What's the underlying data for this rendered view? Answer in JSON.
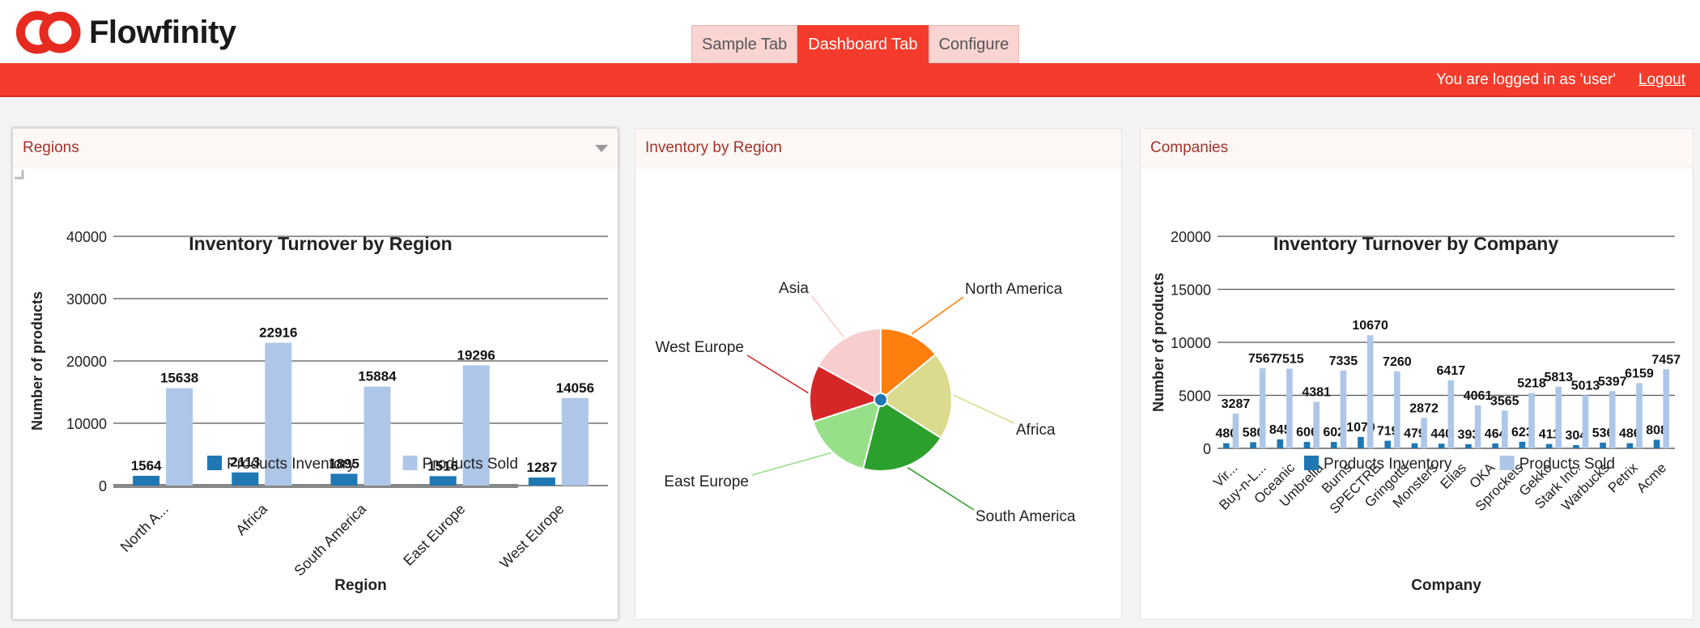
{
  "app": {
    "brand": "Flowfinity",
    "brand_color": "#e62a1f"
  },
  "tabs": [
    {
      "label": "Sample Tab",
      "active": false
    },
    {
      "label": "Dashboard Tab",
      "active": true
    },
    {
      "label": "Configure",
      "active": false
    }
  ],
  "topbar": {
    "login_text": "You are logged in as 'user'",
    "logout_label": "Logout",
    "color": "#f53c2c"
  },
  "panels": {
    "regions": {
      "title": "Regions"
    },
    "inventory": {
      "title": "Inventory by Region"
    },
    "companies": {
      "title": "Companies"
    }
  },
  "chart_data": [
    {
      "type": "bar",
      "title": "Inventory Turnover by Region",
      "xlabel": "Region",
      "ylabel": "Number of products",
      "ylim": [
        0,
        40000
      ],
      "yticks": [
        0,
        10000,
        20000,
        30000,
        40000
      ],
      "grid": true,
      "legend_position": "bottom",
      "categories": [
        "North A...",
        "Africa",
        "South America",
        "East Europe",
        "West Europe"
      ],
      "series": [
        {
          "name": "Products Inventory",
          "color": "#1f77b4",
          "values": [
            1564,
            2113,
            1895,
            1516,
            1287
          ]
        },
        {
          "name": "Products Sold",
          "color": "#aec7e8",
          "values": [
            15638,
            22916,
            15884,
            19296,
            14056
          ]
        }
      ]
    },
    {
      "type": "pie",
      "categories": [
        "North America",
        "Africa",
        "South America",
        "East Europe",
        "West Europe",
        "Asia"
      ],
      "values": [
        14,
        20,
        20,
        16,
        13,
        17
      ],
      "colors": [
        "#ff7f0e",
        "#dbdb8d",
        "#2ca02c",
        "#98df8a",
        "#d62728",
        "#f7cdcd"
      ]
    },
    {
      "type": "bar",
      "title": "Inventory Turnover by Company",
      "xlabel": "Company",
      "ylabel": "Number of products",
      "ylim": [
        0,
        20000
      ],
      "yticks": [
        0,
        5000,
        10000,
        15000,
        20000
      ],
      "grid": true,
      "legend_position": "bottom",
      "categories": [
        "Vir...",
        "Buy-n-L...",
        "Oceanic",
        "Umbrella",
        "Burns",
        "SPECTRE",
        "Gringotts",
        "Monsters",
        "Elias",
        "OKA",
        "Sprockets",
        "Gekko",
        "Stark Inc.",
        "Warbucks",
        "Petrix",
        "Acme"
      ],
      "series": [
        {
          "name": "Products Inventory",
          "color": "#1f77b4",
          "values": [
            480,
            580,
            845,
            606,
            602,
            1070,
            719,
            479,
            440,
            393,
            464,
            623,
            411,
            304,
            536,
            486,
            808
          ]
        },
        {
          "name": "Products Sold",
          "color": "#aec7e8",
          "values": [
            3287,
            7567,
            7515,
            4381,
            7335,
            10670,
            7260,
            2872,
            6417,
            4061,
            3565,
            5218,
            5813,
            5013,
            5397,
            6159,
            7457
          ]
        }
      ]
    }
  ]
}
